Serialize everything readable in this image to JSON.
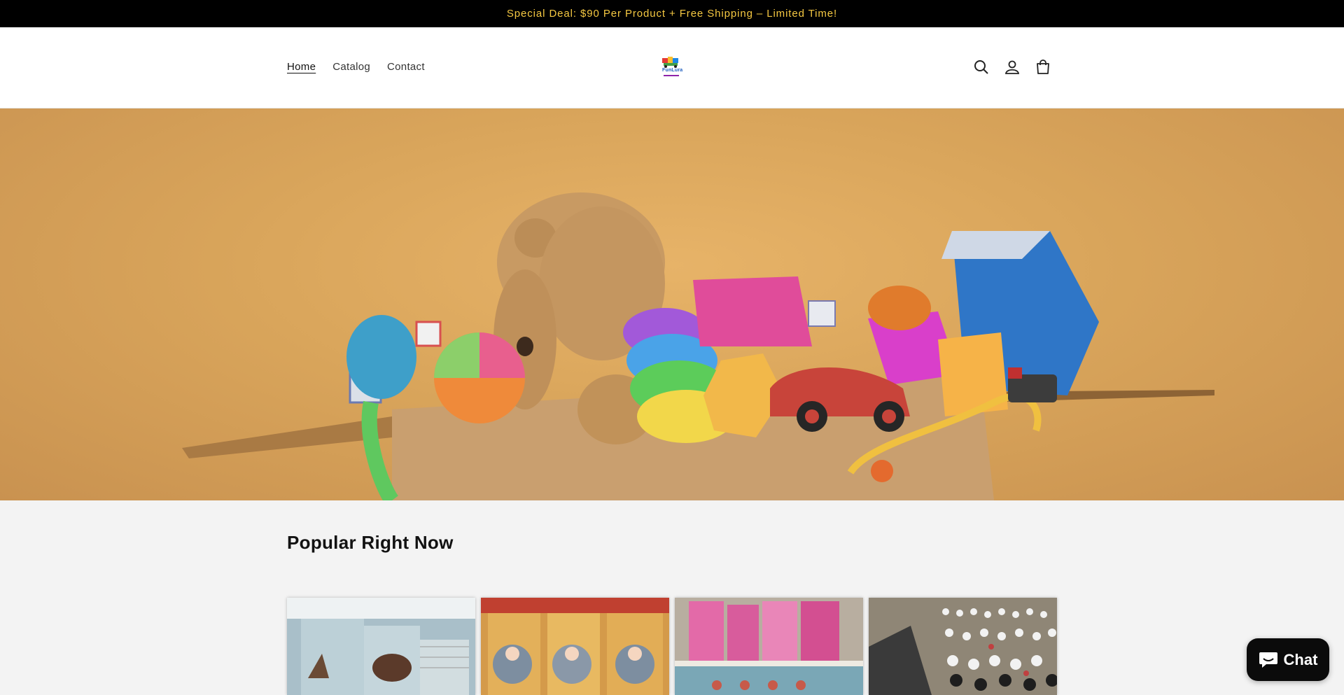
{
  "announcement": {
    "text": "Special Deal: $90 Per Product + Free Shipping – Limited Time!"
  },
  "nav": {
    "items": [
      {
        "label": "Home",
        "active": true
      },
      {
        "label": "Catalog",
        "active": false
      },
      {
        "label": "Contact",
        "active": false
      }
    ]
  },
  "logo": {
    "text": "FunLura"
  },
  "header_icons": [
    "search-icon",
    "account-icon",
    "cart-icon"
  ],
  "hero": {
    "alt": "Box of colorful toys with teddy bear"
  },
  "popular": {
    "title": "Popular Right Now",
    "products": [
      {
        "image": "dollhouse-furniture"
      },
      {
        "image": "lalaloopsy-dolls"
      },
      {
        "image": "boxed-dolls-shelf"
      },
      {
        "image": "minifigure-collection"
      }
    ]
  },
  "chat": {
    "label": "Chat"
  },
  "colors": {
    "announcement_bg": "#000000",
    "announcement_text": "#f5c842",
    "hero_bg": "#d9a55b",
    "page_bg": "#f3f3f3"
  }
}
